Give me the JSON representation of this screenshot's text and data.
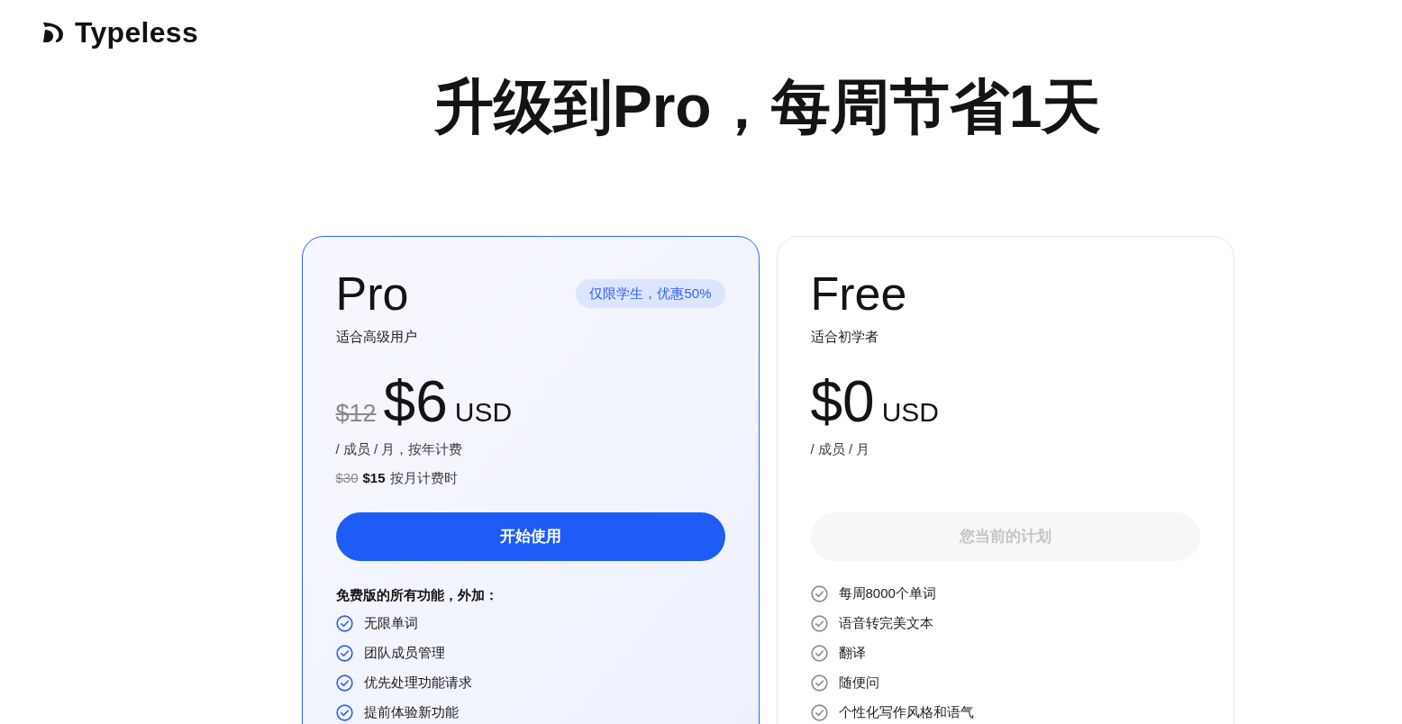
{
  "brand": {
    "name": "Typeless"
  },
  "heading": "升级到Pro，每周节省1天",
  "plans": [
    {
      "name": "Pro",
      "highlighted": true,
      "badge": "仅限学生，优惠50%",
      "tagline": "适合高级用户",
      "original_price": "$12",
      "price": "$6",
      "currency": "USD",
      "billing": "/ 成员 / 月，按年计费",
      "monthly_note": {
        "original_price": "$30",
        "price": "$15",
        "text": "按月计费时"
      },
      "button": {
        "label": "开始使用",
        "disabled": false
      },
      "features_heading": "免费版的所有功能，外加：",
      "features": [
        "无限单词",
        "团队成员管理",
        "优先处理功能请求",
        "提前体验新功能"
      ]
    },
    {
      "name": "Free",
      "highlighted": false,
      "tagline": "适合初学者",
      "price": "$0",
      "currency": "USD",
      "billing": "/ 成员 / 月",
      "button": {
        "label": "您当前的计划",
        "disabled": true
      },
      "features": [
        "每周8000个单词",
        "语音转完美文本",
        "翻译",
        "随便问",
        "个性化写作风格和语气"
      ]
    }
  ]
}
